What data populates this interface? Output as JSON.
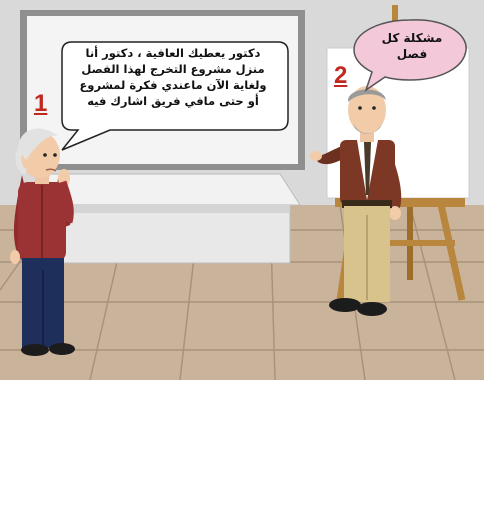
{
  "scene": {
    "characters": [
      {
        "id": "student",
        "label": "1"
      },
      {
        "id": "teacher",
        "label": "2"
      }
    ],
    "bubbles": {
      "student_line1": "دكتور يعطيك العافية ، دكتور أنا",
      "student_line2": "منزل مشروع التخرج لهذا الفصل",
      "student_line3": "ولغاية الآن ماعندي فكرة لمشروع",
      "student_line4": "أو حتى مافي فريق اشارك فيه",
      "teacher_line1": "مشكلة كل",
      "teacher_line2": "فصل"
    },
    "colors": {
      "wall": "#d9d9d9",
      "floor": "#c8b49a",
      "board_frame": "#8c8c8c",
      "teacher_bubble": "#f3c9d9",
      "marker": "#c0291f"
    }
  }
}
